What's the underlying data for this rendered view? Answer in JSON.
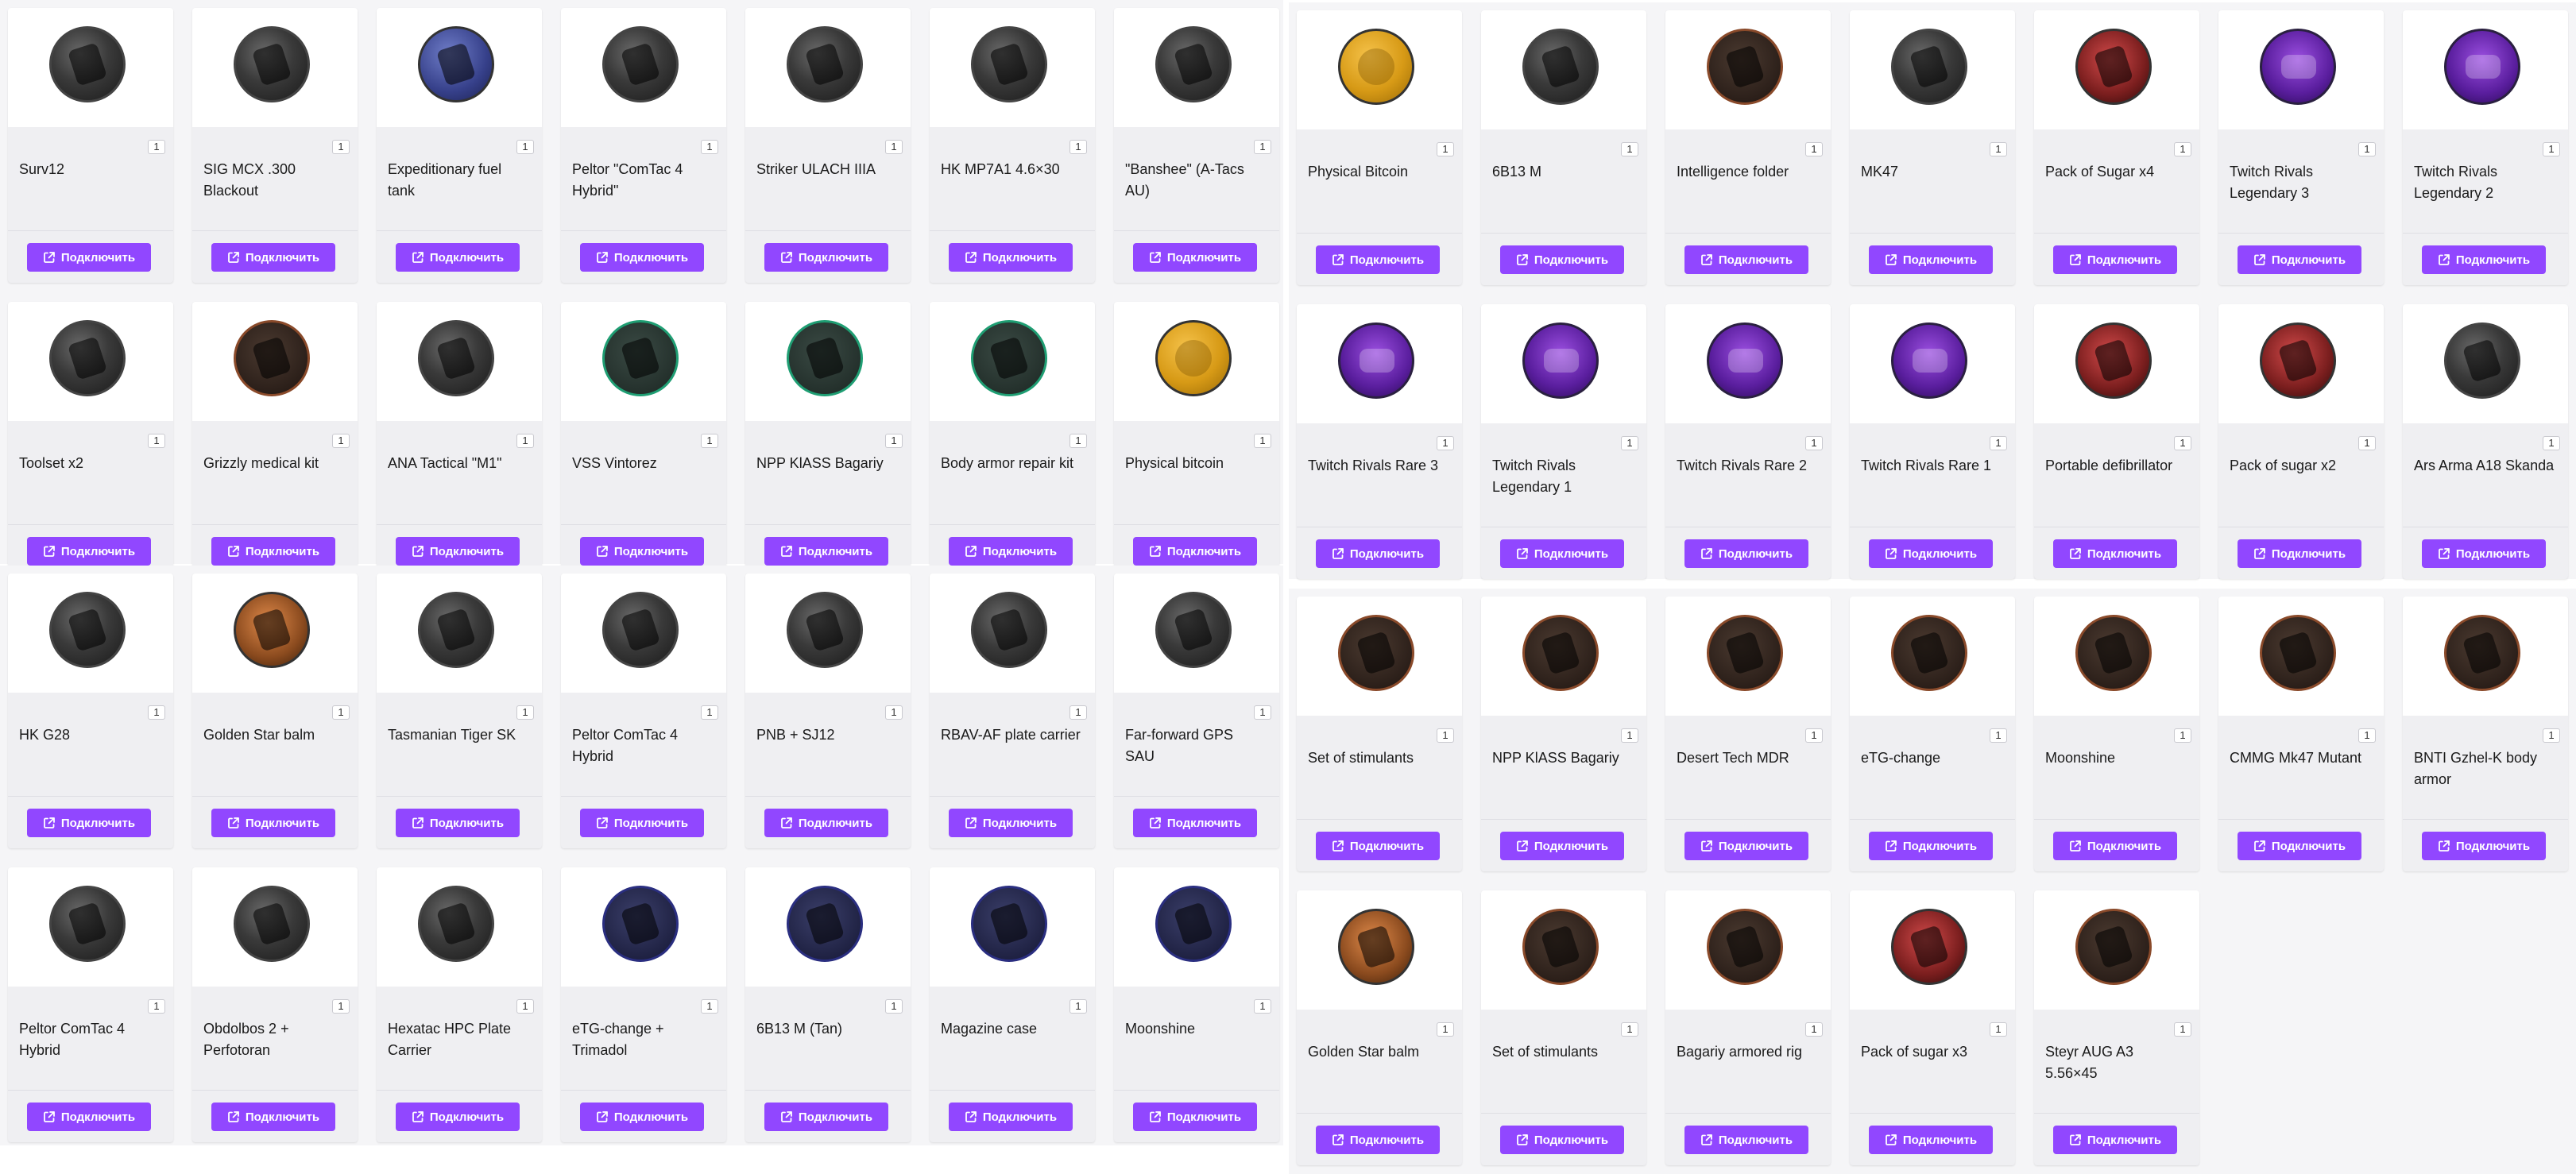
{
  "accent_color": "#9147ff",
  "connect_icon": "external-link-icon",
  "panels": [
    {
      "id": "p1",
      "cards": [
        {
          "name": "Surv12",
          "qty": "1",
          "icon": "dark",
          "btn": "Подключить"
        },
        {
          "name": "SIG MCX .300 Blackout",
          "qty": "1",
          "icon": "dark",
          "btn": "Подключить"
        },
        {
          "name": "Expeditionary fuel tank",
          "qty": "1",
          "icon": "blue",
          "btn": "Подключить"
        },
        {
          "name": "Peltor \"ComTac 4 Hybrid\"",
          "qty": "1",
          "icon": "dark",
          "btn": "Подключить"
        },
        {
          "name": "Striker ULACH IIIA",
          "qty": "1",
          "icon": "dark",
          "btn": "Подключить"
        },
        {
          "name": "HK MP7A1 4.6×30",
          "qty": "1",
          "icon": "dark",
          "btn": "Подключить"
        },
        {
          "name": "\"Banshee\" (A-Tacs AU)",
          "qty": "1",
          "icon": "dark",
          "btn": "Подключить"
        },
        {
          "name": "Toolset x2",
          "qty": "1",
          "icon": "dark",
          "btn": "Подключить"
        },
        {
          "name": "Grizzly medical kit",
          "qty": "1",
          "icon": "brown",
          "btn": "Подключить"
        },
        {
          "name": "ANA Tactical \"M1\"",
          "qty": "1",
          "icon": "dark",
          "btn": "Подключить"
        },
        {
          "name": "VSS Vintorez",
          "qty": "1",
          "icon": "green",
          "btn": "Подключить"
        },
        {
          "name": "NPP KlASS Bagariy",
          "qty": "1",
          "icon": "green",
          "btn": "Подключить"
        },
        {
          "name": "Body armor repair kit",
          "qty": "1",
          "icon": "green",
          "btn": "Подключить"
        },
        {
          "name": "Physical bitcoin",
          "qty": "1",
          "icon": "gold",
          "btn": "Подключить"
        }
      ]
    },
    {
      "id": "p2",
      "cards": [
        {
          "name": "Physical Bitcoin",
          "qty": "1",
          "icon": "gold",
          "btn": "Подключить"
        },
        {
          "name": "6B13 M",
          "qty": "1",
          "icon": "dark",
          "btn": "Подключить"
        },
        {
          "name": "Intelligence folder",
          "qty": "1",
          "icon": "brown",
          "btn": "Подключить"
        },
        {
          "name": "MK47",
          "qty": "1",
          "icon": "dark",
          "btn": "Подключить"
        },
        {
          "name": "Pack of Sugar x4",
          "qty": "1",
          "icon": "red",
          "btn": "Подключить"
        },
        {
          "name": "Twitch Rivals Legendary 3",
          "qty": "1",
          "icon": "purple",
          "btn": "Подключить"
        },
        {
          "name": "Twitch Rivals Legendary 2",
          "qty": "1",
          "icon": "purple",
          "btn": "Подключить"
        },
        {
          "name": "Twitch Rivals Rare 3",
          "qty": "1",
          "icon": "purple",
          "btn": "Подключить"
        },
        {
          "name": "Twitch Rivals Legendary 1",
          "qty": "1",
          "icon": "purple",
          "btn": "Подключить"
        },
        {
          "name": "Twitch Rivals Rare 2",
          "qty": "1",
          "icon": "purple",
          "btn": "Подключить"
        },
        {
          "name": "Twitch Rivals Rare 1",
          "qty": "1",
          "icon": "purple",
          "btn": "Подключить"
        },
        {
          "name": "Portable defibrillator",
          "qty": "1",
          "icon": "red",
          "btn": "Подключить"
        },
        {
          "name": "Pack of sugar x2",
          "qty": "1",
          "icon": "red",
          "btn": "Подключить"
        },
        {
          "name": "Ars Arma A18 Skanda",
          "qty": "1",
          "icon": "dark",
          "btn": "Подключить"
        }
      ]
    },
    {
      "id": "p3",
      "cards": [
        {
          "name": "HK G28",
          "qty": "1",
          "icon": "dark",
          "btn": "Подключить"
        },
        {
          "name": "Golden Star balm",
          "qty": "1",
          "icon": "orange",
          "btn": "Подключить"
        },
        {
          "name": "Tasmanian Tiger SK",
          "qty": "1",
          "icon": "dark",
          "btn": "Подключить"
        },
        {
          "name": "Peltor ComTac 4 Hybrid",
          "qty": "1",
          "icon": "dark",
          "btn": "Подключить"
        },
        {
          "name": "PNB + SJ12",
          "qty": "1",
          "icon": "dark",
          "btn": "Подключить"
        },
        {
          "name": "RBAV-AF plate carrier",
          "qty": "1",
          "icon": "dark",
          "btn": "Подключить"
        },
        {
          "name": "Far-forward GPS SAU",
          "qty": "1",
          "icon": "dark",
          "btn": "Подключить"
        },
        {
          "name": "Peltor ComTac 4 Hybrid",
          "qty": "1",
          "icon": "dark",
          "btn": "Подключить"
        },
        {
          "name": "Obdolbos 2 + Perfotoran",
          "qty": "1",
          "icon": "dark",
          "btn": "Подключить"
        },
        {
          "name": "Hexatac HPC Plate Carrier",
          "qty": "1",
          "icon": "dark",
          "btn": "Подключить"
        },
        {
          "name": "eTG-change + Trimadol",
          "qty": "1",
          "icon": "navy",
          "btn": "Подключить"
        },
        {
          "name": "6B13 M (Tan)",
          "qty": "1",
          "icon": "navy",
          "btn": "Подключить"
        },
        {
          "name": "Magazine case",
          "qty": "1",
          "icon": "navy",
          "btn": "Подключить"
        },
        {
          "name": "Moonshine",
          "qty": "1",
          "icon": "navy",
          "btn": "Подключить"
        }
      ]
    },
    {
      "id": "p4",
      "cards": [
        {
          "name": "Set of stimulants",
          "qty": "1",
          "icon": "brown",
          "btn": "Подключить"
        },
        {
          "name": "NPP KlASS Bagariy",
          "qty": "1",
          "icon": "brown",
          "btn": "Подключить"
        },
        {
          "name": "Desert Tech MDR",
          "qty": "1",
          "icon": "brown",
          "btn": "Подключить"
        },
        {
          "name": "eTG-change",
          "qty": "1",
          "icon": "brown",
          "btn": "Подключить"
        },
        {
          "name": "Moonshine",
          "qty": "1",
          "icon": "brown",
          "btn": "Подключить"
        },
        {
          "name": "CMMG Mk47 Mutant",
          "qty": "1",
          "icon": "brown",
          "btn": "Подключить"
        },
        {
          "name": "BNTI Gzhel-K body armor",
          "qty": "1",
          "icon": "brown",
          "btn": "Подключить"
        },
        {
          "name": "Golden Star balm",
          "qty": "1",
          "icon": "orange",
          "btn": "Подключить"
        },
        {
          "name": "Set of stimulants",
          "qty": "1",
          "icon": "brown",
          "btn": "Подключить"
        },
        {
          "name": "Bagariy armored rig",
          "qty": "1",
          "icon": "brown",
          "btn": "Подключить"
        },
        {
          "name": "Pack of sugar x3",
          "qty": "1",
          "icon": "red",
          "btn": "Подключить"
        },
        {
          "name": "Steyr AUG A3 5.56×45",
          "qty": "1",
          "icon": "brown",
          "btn": "Подключить"
        }
      ]
    }
  ]
}
